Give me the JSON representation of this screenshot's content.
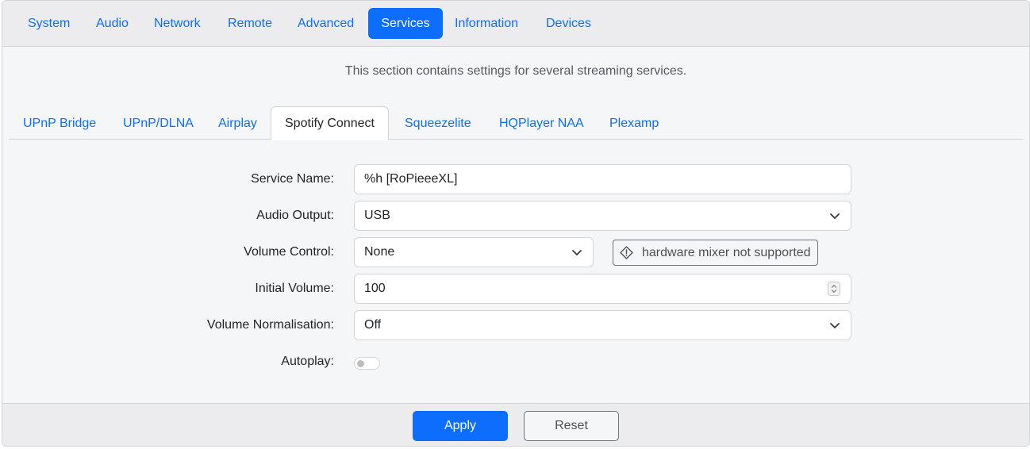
{
  "top_nav": {
    "tabs": [
      {
        "label": "System"
      },
      {
        "label": "Audio"
      },
      {
        "label": "Network"
      },
      {
        "label": "Remote"
      },
      {
        "label": "Advanced"
      },
      {
        "label": "Services",
        "active": true
      },
      {
        "label": "Information"
      },
      {
        "label": "Devices"
      }
    ]
  },
  "intro_text": "This section contains settings for several streaming services.",
  "sub_nav": {
    "tabs": [
      {
        "label": "UPnP Bridge"
      },
      {
        "label": "UPnP/DLNA"
      },
      {
        "label": "Airplay"
      },
      {
        "label": "Spotify Connect",
        "active": true
      },
      {
        "label": "Squeezelite"
      },
      {
        "label": "HQPlayer NAA"
      },
      {
        "label": "Plexamp"
      }
    ]
  },
  "form": {
    "service_name": {
      "label": "Service Name:",
      "value": "%h [RoPieeeXL]"
    },
    "audio_output": {
      "label": "Audio Output:",
      "value": "USB"
    },
    "volume_control": {
      "label": "Volume Control:",
      "value": "None",
      "hint": "hardware mixer not supported"
    },
    "initial_volume": {
      "label": "Initial Volume:",
      "value": "100"
    },
    "volume_normalisation": {
      "label": "Volume Normalisation:",
      "value": "Off"
    },
    "autoplay": {
      "label": "Autoplay:",
      "enabled": false
    }
  },
  "footer": {
    "apply_label": "Apply",
    "reset_label": "Reset"
  },
  "icons": {
    "select_caret": "chevron-down-icon",
    "hint": "warning-icon",
    "number_spinner": "spinner-arrows-icon"
  },
  "colors": {
    "accent": "#0d6efd",
    "panel_bg": "#f5f6f7",
    "nav_bg": "#ececee",
    "border": "#d3d5d8"
  }
}
